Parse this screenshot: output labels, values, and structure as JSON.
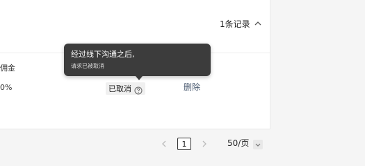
{
  "header": {
    "record_count": "1条记录"
  },
  "table": {
    "column_header_fragment": "佣金",
    "row": {
      "percent_fragment": "0%",
      "status": "已取消",
      "delete_label": "删除"
    }
  },
  "tooltip": {
    "title": "经过线下沟通之后,",
    "detail": "请求已被取消"
  },
  "pagination": {
    "current_page": "1",
    "page_size": "50/页"
  }
}
